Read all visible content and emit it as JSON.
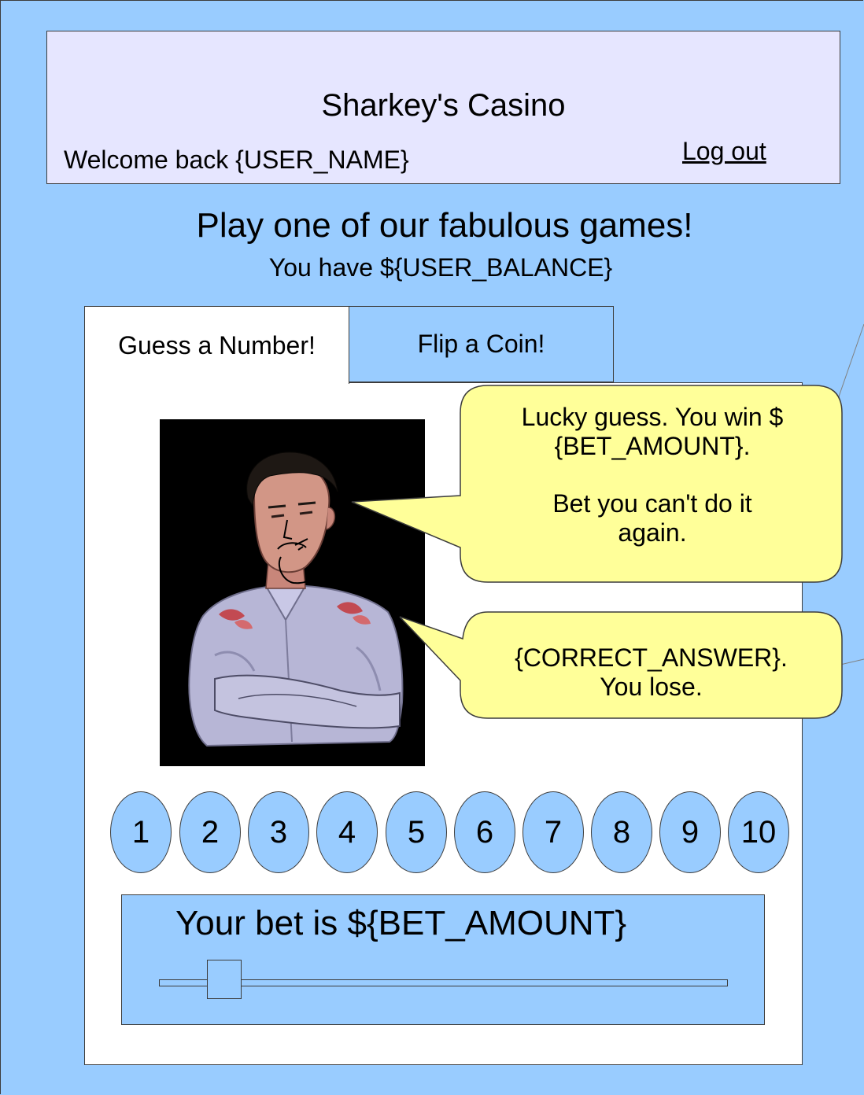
{
  "header": {
    "title": "Sharkey's Casino",
    "welcome": "Welcome back {USER_NAME}",
    "logout_label": "Log out"
  },
  "main": {
    "headline": "Play one of our fabulous games!",
    "balance": "You have ${USER_BALANCE}"
  },
  "tabs": [
    {
      "label": "Guess a Number!",
      "active": true
    },
    {
      "label": "Flip a Coin!",
      "active": false
    }
  ],
  "bubbles": {
    "win": "Lucky guess. You win $\n{BET_AMOUNT}.\n\nBet you can't do it\nagain.",
    "lose": "{CORRECT_ANSWER}.\nYou lose."
  },
  "numbers": [
    "1",
    "2",
    "3",
    "4",
    "5",
    "6",
    "7",
    "8",
    "9",
    "10"
  ],
  "bet": {
    "label": "Your bet is ${BET_AMOUNT}",
    "slider_level": 0.09
  },
  "colors": {
    "background": "#99ccff",
    "header_fill": "#e6e6ff",
    "bubble_fill": "#ffff99",
    "outline": "#3c3c3c"
  }
}
